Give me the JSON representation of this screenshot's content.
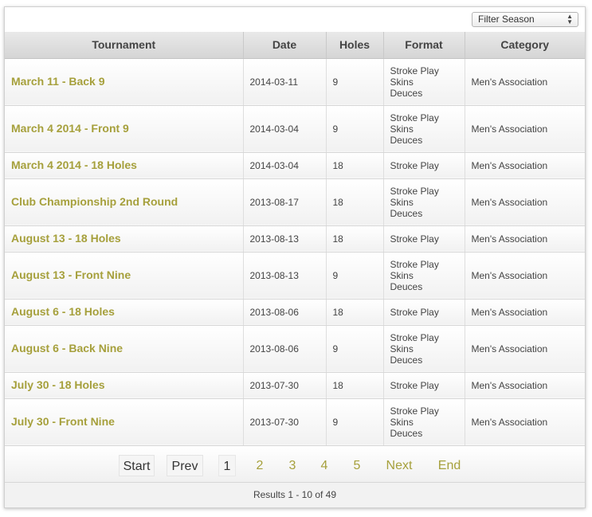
{
  "filter": {
    "label": "Filter Season"
  },
  "table": {
    "headers": [
      "Tournament",
      "Date",
      "Holes",
      "Format",
      "Category"
    ],
    "rows": [
      {
        "name": "March 11 - Back 9",
        "date": "2014-03-11",
        "holes": "9",
        "format": [
          "Stroke Play",
          "Skins",
          "Deuces"
        ],
        "category": "Men's Association"
      },
      {
        "name": "March 4 2014 - Front 9",
        "date": "2014-03-04",
        "holes": "9",
        "format": [
          "Stroke Play",
          "Skins",
          "Deuces"
        ],
        "category": "Men's Association"
      },
      {
        "name": "March 4 2014 - 18 Holes",
        "date": "2014-03-04",
        "holes": "18",
        "format": [
          "Stroke Play"
        ],
        "category": "Men's Association"
      },
      {
        "name": "Club Championship 2nd Round",
        "date": "2013-08-17",
        "holes": "18",
        "format": [
          "Stroke Play",
          "Skins",
          "Deuces"
        ],
        "category": "Men's Association"
      },
      {
        "name": "August 13 - 18 Holes",
        "date": "2013-08-13",
        "holes": "18",
        "format": [
          "Stroke Play"
        ],
        "category": "Men's Association"
      },
      {
        "name": "August 13 - Front Nine",
        "date": "2013-08-13",
        "holes": "9",
        "format": [
          "Stroke Play",
          "Skins",
          "Deuces"
        ],
        "category": "Men's Association"
      },
      {
        "name": "August 6 - 18 Holes",
        "date": "2013-08-06",
        "holes": "18",
        "format": [
          "Stroke Play"
        ],
        "category": "Men's Association"
      },
      {
        "name": "August 6 - Back Nine",
        "date": "2013-08-06",
        "holes": "9",
        "format": [
          "Stroke Play",
          "Skins",
          "Deuces"
        ],
        "category": "Men's Association"
      },
      {
        "name": "July 30 - 18 Holes",
        "date": "2013-07-30",
        "holes": "18",
        "format": [
          "Stroke Play"
        ],
        "category": "Men's Association"
      },
      {
        "name": "July 30 - Front Nine",
        "date": "2013-07-30",
        "holes": "9",
        "format": [
          "Stroke Play",
          "Skins",
          "Deuces"
        ],
        "category": "Men's Association"
      }
    ]
  },
  "pagination": {
    "start": "Start",
    "prev": "Prev",
    "pages": [
      "1",
      "2",
      "3",
      "4",
      "5"
    ],
    "current": "1",
    "next": "Next",
    "end": "End"
  },
  "results": "Results 1 - 10 of 49",
  "colors": {
    "link": "#a6a03c",
    "header_bg": "#dcdcdc",
    "border": "#d0d0d0"
  }
}
